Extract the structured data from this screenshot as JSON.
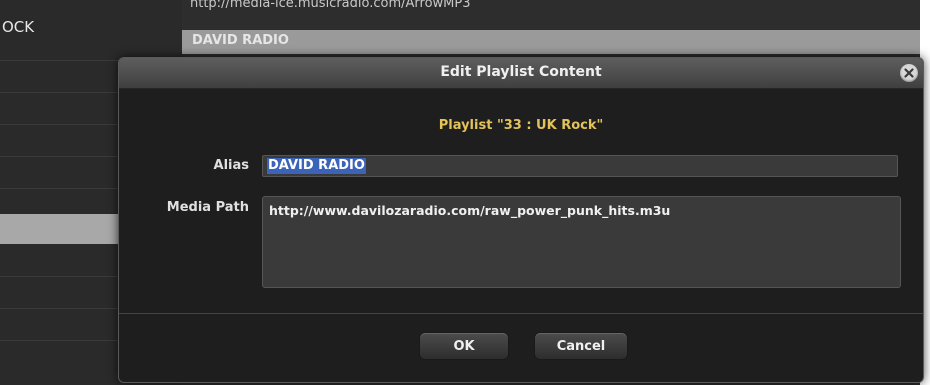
{
  "background": {
    "left_panel_title": "OCK",
    "stream_url": "http://media-ice.musicradio.com/ArrowMP3",
    "selected_row_label": "DAVID RADIO"
  },
  "dialog": {
    "title": "Edit Playlist Content",
    "playlist_heading": "Playlist \"33 : UK Rock\"",
    "alias": {
      "label": "Alias",
      "value": "DAVID RADIO"
    },
    "media_path": {
      "label": "Media Path",
      "value": "http://www.davilozaradio.com/raw_power_punk_hits.m3u"
    },
    "buttons": {
      "ok_label": "OK",
      "cancel_label": "Cancel"
    },
    "close_icon": "close-icon"
  },
  "colors": {
    "heading_accent": "#e3c25a",
    "selection_blue": "#3b63b7",
    "dialog_bg": "#1e1e1e"
  }
}
